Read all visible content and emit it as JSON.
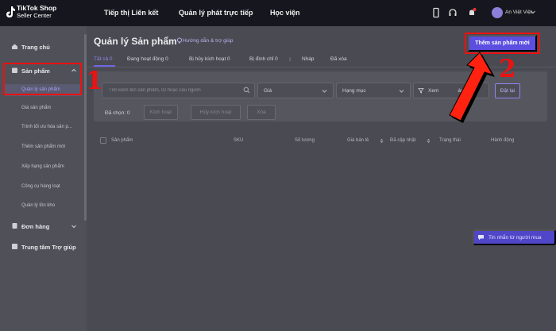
{
  "topbar": {
    "logo_line1": "TikTok Shop",
    "logo_line2": "Seller Center",
    "nav": [
      "Tiếp thị Liên kết",
      "Quản lý phát trực tiếp",
      "Học viện"
    ],
    "user_name": "An Việt Việt"
  },
  "sidebar": {
    "home": "Trang chủ",
    "products": "Sản phẩm",
    "product_items": [
      "Quản lý sản phẩm",
      "Giá sản phẩm",
      "Trình tối ưu hóa sản p...",
      "Thêm sản phẩm mới",
      "Xếp hạng sản phẩm",
      "Công cụ hàng loạt",
      "Quản lý tồn kho"
    ],
    "orders": "Đơn hàng",
    "help_center": "Trung tâm Trợ giúp"
  },
  "main": {
    "title": "Quản lý Sản phẩm",
    "help_link": "Hướng dẫn & trợ giúp",
    "add_button": "Thêm sản phẩm mới",
    "tabs": [
      "Tất cả 0",
      "Đang hoạt động 0",
      "Bị hủy kích hoạt 0",
      "Bị đình chỉ 0",
      "Nháp",
      "Đã xóa"
    ],
    "search_placeholder": "Tìm kiếm tên sản phẩm, ID hoặc câu người",
    "filters": [
      "Giá",
      "Hạng mục",
      "Xem",
      "ác"
    ],
    "reset_button": "Đặt lại",
    "selected_label": "Đã chọn: 0",
    "bulk_actions": [
      "Kích hoạt",
      "Hủy kích hoạt",
      "Xóa"
    ],
    "columns": [
      "Sản phẩm",
      "SKU",
      "Số lượng",
      "Giá bán lẻ",
      "Đã cập nhật",
      "Trạng thái",
      "Hành động"
    ],
    "chat_button": "Tin nhắn từ người mua"
  },
  "annotations": {
    "step1": "1",
    "step2": "2"
  },
  "colors": {
    "accent": "#5b4ee0",
    "annotation_red": "#e11111",
    "topbar": "#16161e"
  }
}
